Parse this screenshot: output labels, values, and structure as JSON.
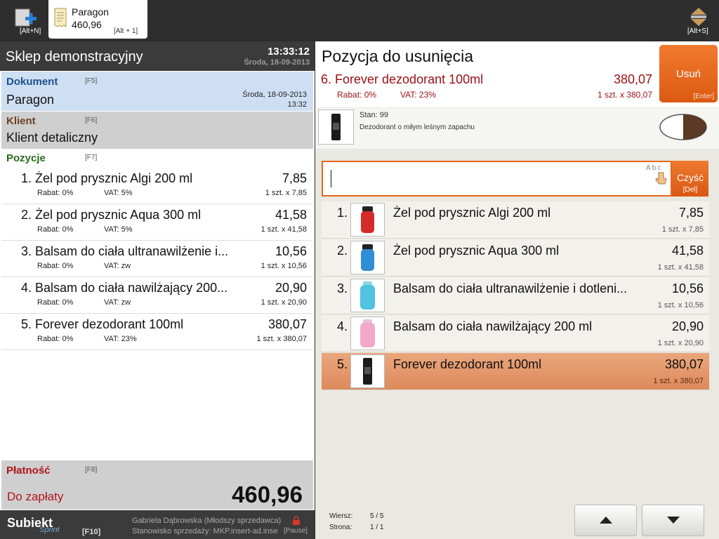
{
  "topbar": {
    "new_shortcut": "[Alt+N]",
    "doc_tab": {
      "name": "Paragon",
      "amount": "460,96",
      "shortcut": "[Alt + 1]"
    },
    "sort_shortcut": "[Alt+S]"
  },
  "shop": {
    "name": "Sklep demonstracyjny",
    "time": "13:33:12",
    "date": "Środa, 18-09-2013"
  },
  "document": {
    "title": "Dokument",
    "key": "[F5]",
    "value": "Paragon",
    "date": "Środa, 18-09-2013",
    "hour": "13:32"
  },
  "client": {
    "title": "Klient",
    "key": "[F6]",
    "value": "Klient detaliczny"
  },
  "positions": {
    "title": "Pozycje",
    "key": "[F7]",
    "items": [
      {
        "name": "1. Żel pod prysznic Algi 200 ml",
        "price": "7,85",
        "rabat": "Rabat: 0%",
        "vat": "VAT: 5%",
        "qty": "1 szt. x 7,85"
      },
      {
        "name": "2. Żel pod prysznic Aqua 300 ml",
        "price": "41,58",
        "rabat": "Rabat: 0%",
        "vat": "VAT: 5%",
        "qty": "1 szt. x 41,58"
      },
      {
        "name": "3. Balsam do ciała ultranawilżenie i...",
        "price": "10,56",
        "rabat": "Rabat: 0%",
        "vat": "VAT: zw",
        "qty": "1 szt. x 10,56"
      },
      {
        "name": "4. Balsam do ciała nawilżający 200...",
        "price": "20,90",
        "rabat": "Rabat: 0%",
        "vat": "VAT: zw",
        "qty": "1 szt. x 20,90"
      },
      {
        "name": "5. Forever dezodorant 100ml",
        "price": "380,07",
        "rabat": "Rabat: 0%",
        "vat": "VAT: 23%",
        "qty": "1 szt. x 380,07"
      }
    ]
  },
  "payment": {
    "title": "Płatność",
    "key": "[F8]",
    "label": "Do zapłaty",
    "amount": "460,96"
  },
  "footer": {
    "logo": "Subiekt",
    "logo_sub": "Sprint",
    "menu_key": "[F10]",
    "user": "Gabriela Dąbrowska (Młodszy sprzedawca)",
    "station": "Stanowisko sprzedaży: MKP.insert-ad.insert....",
    "pause_key": "[Pause]"
  },
  "removal": {
    "title": "Pozycja do usunięcia",
    "item_name": "6. Forever dezodorant 100ml",
    "item_price": "380,07",
    "rabat": "Rabat: 0%",
    "vat": "VAT: 23%",
    "qty": "1 szt. x 380,07",
    "remove_label": "Usuń",
    "remove_key": "[Enter]",
    "stock": "Stan: 99",
    "description": "Dezodorant o miłym leśnym zapachu"
  },
  "search": {
    "value": "",
    "abc_hint": "Abc",
    "clear_label": "Czyść",
    "clear_key": "[Del]"
  },
  "results": {
    "items": [
      {
        "num": "1.",
        "name": "Żel pod prysznic Algi 200 ml",
        "price": "7,85",
        "qty": "1 szt. x 7,85",
        "color": "#d42a2a"
      },
      {
        "num": "2.",
        "name": "Żel pod prysznic Aqua 300 ml",
        "price": "41,58",
        "qty": "1 szt. x 41,58",
        "color": "#2f8fd6"
      },
      {
        "num": "3.",
        "name": "Balsam do ciała ultranawilżenie i dotleni...",
        "price": "10,56",
        "qty": "1 szt. x 10,56",
        "color": "#4fc3e0"
      },
      {
        "num": "4.",
        "name": "Balsam do ciała nawilżający 200 ml",
        "price": "20,90",
        "qty": "1 szt. x 20,90",
        "color": "#f2a8c8"
      },
      {
        "num": "5.",
        "name": "Forever dezodorant 100ml",
        "price": "380,07",
        "qty": "1 szt. x 380,07",
        "color": "#1b1b1b"
      }
    ]
  },
  "pager": {
    "row_label": "Wiersz:",
    "row_value": "5 / 5",
    "page_label": "Strona:",
    "page_value": "1 / 1"
  },
  "colors": {
    "accent": "#e2681d",
    "danger": "#9b0f14",
    "selected_row": "#e59a6c"
  }
}
